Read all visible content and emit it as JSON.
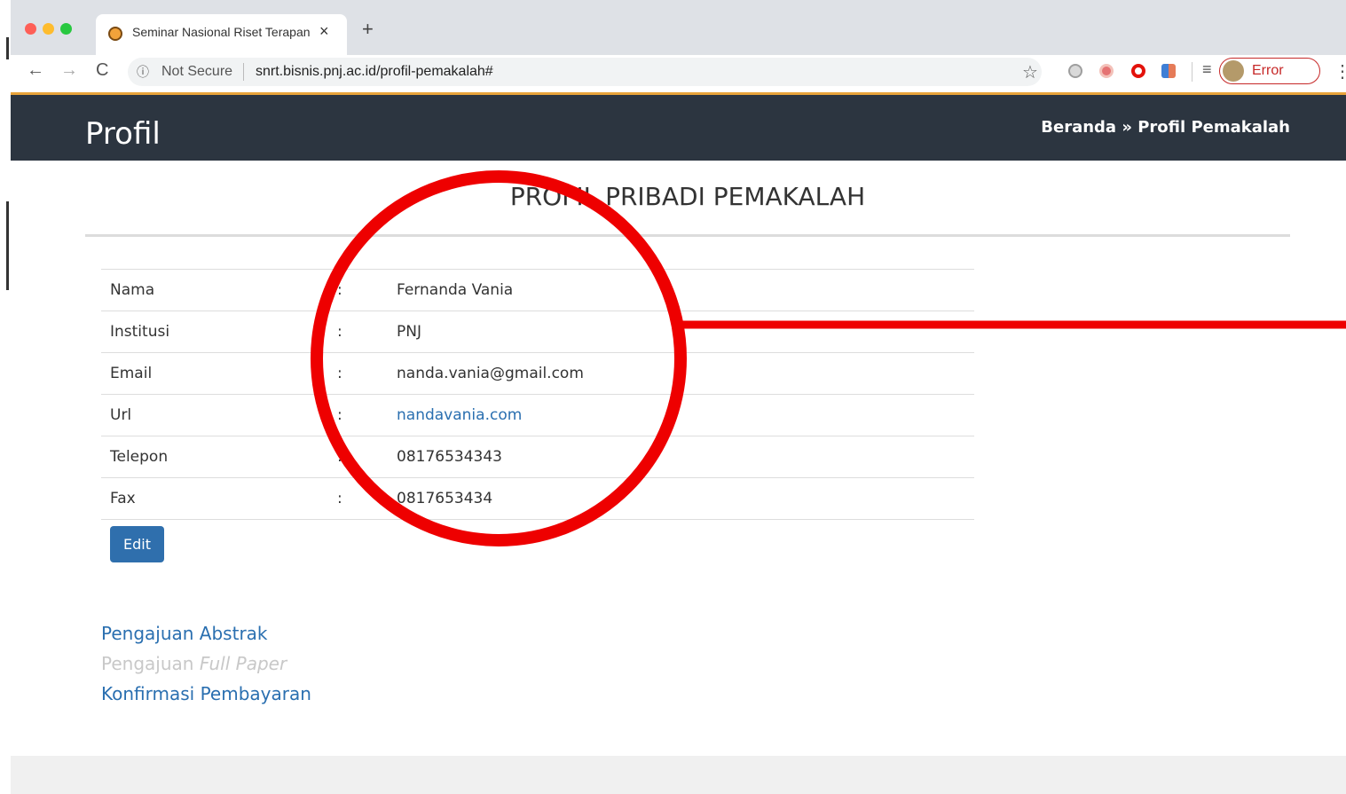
{
  "browser": {
    "tab_title": "Seminar Nasional Riset Terapan",
    "tab_close": "×",
    "new_tab": "+",
    "back": "←",
    "forward": "→",
    "reload": "C",
    "info": "ⓘ",
    "not_secure": "Not Secure",
    "url": "snrt.bisnis.pnj.ac.id/profil-pemakalah#",
    "bookmark": "☆",
    "error_label": "Error",
    "menu": "⋮"
  },
  "header": {
    "title": "Profil",
    "breadcrumb": "Beranda » Profil Pemakalah"
  },
  "main": {
    "heading": "PROFIL PRIBADI PEMAKALAH",
    "separator": ":",
    "rows": [
      {
        "label": "Nama",
        "value": "Fernanda Vania"
      },
      {
        "label": "Institusi",
        "value": "PNJ"
      },
      {
        "label": "Email",
        "value": "nanda.vania@gmail.com"
      },
      {
        "label": "Url",
        "value": "nandavania.com"
      },
      {
        "label": "Telepon",
        "value": "08176534343"
      },
      {
        "label": "Fax",
        "value": "0817653434"
      }
    ],
    "edit_label": "Edit",
    "links": {
      "abstract": "Pengajuan Abstrak",
      "fullpaper_prefix": "Pengajuan ",
      "fullpaper_em": "Full Paper",
      "payment": "Konfirmasi Pembayaran"
    }
  },
  "colors": {
    "header_bg": "#2c3540",
    "link": "#2a6fb0",
    "button": "#2f6fad",
    "annotation": "#ee0000"
  }
}
